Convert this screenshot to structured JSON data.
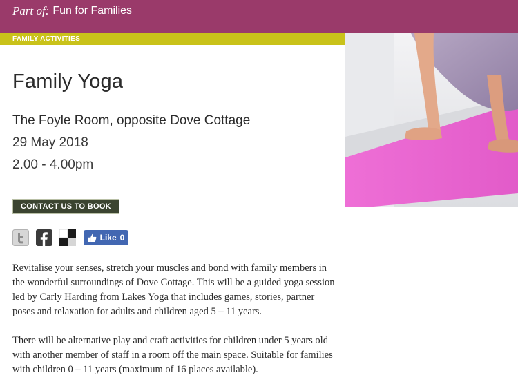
{
  "header": {
    "part_of_label": "Part of:",
    "parent_collection": "Fun for Families",
    "bar_color": "#9a3a6a"
  },
  "category": {
    "label": "FAMILY ACTIVITIES",
    "color": "#c9c21a"
  },
  "event": {
    "title": "Family Yoga",
    "venue": "The Foyle Room, opposite Dove Cottage",
    "date": "29 May 2018",
    "time": "2.00 - 4.00pm"
  },
  "cta": {
    "label": "CONTACT US TO BOOK"
  },
  "social": {
    "icons": [
      "twitter-icon",
      "facebook-icon",
      "delicious-icon"
    ],
    "like_label": "Like",
    "like_count": "0"
  },
  "description": {
    "paragraph_1": "Revitalise your senses, stretch your muscles and bond with family members in the wonderful surroundings of Dove Cottage. This will be a guided yoga session led by Carly Harding from Lakes Yoga that includes games, stories, partner poses and relaxation for adults and children aged 5 – 11 years.",
    "paragraph_2": "There will be alternative play and craft activities for children under 5 years old with another member of staff in a room off the main space. Suitable for families with children 0 – 11 years (maximum of 16 places available)."
  }
}
